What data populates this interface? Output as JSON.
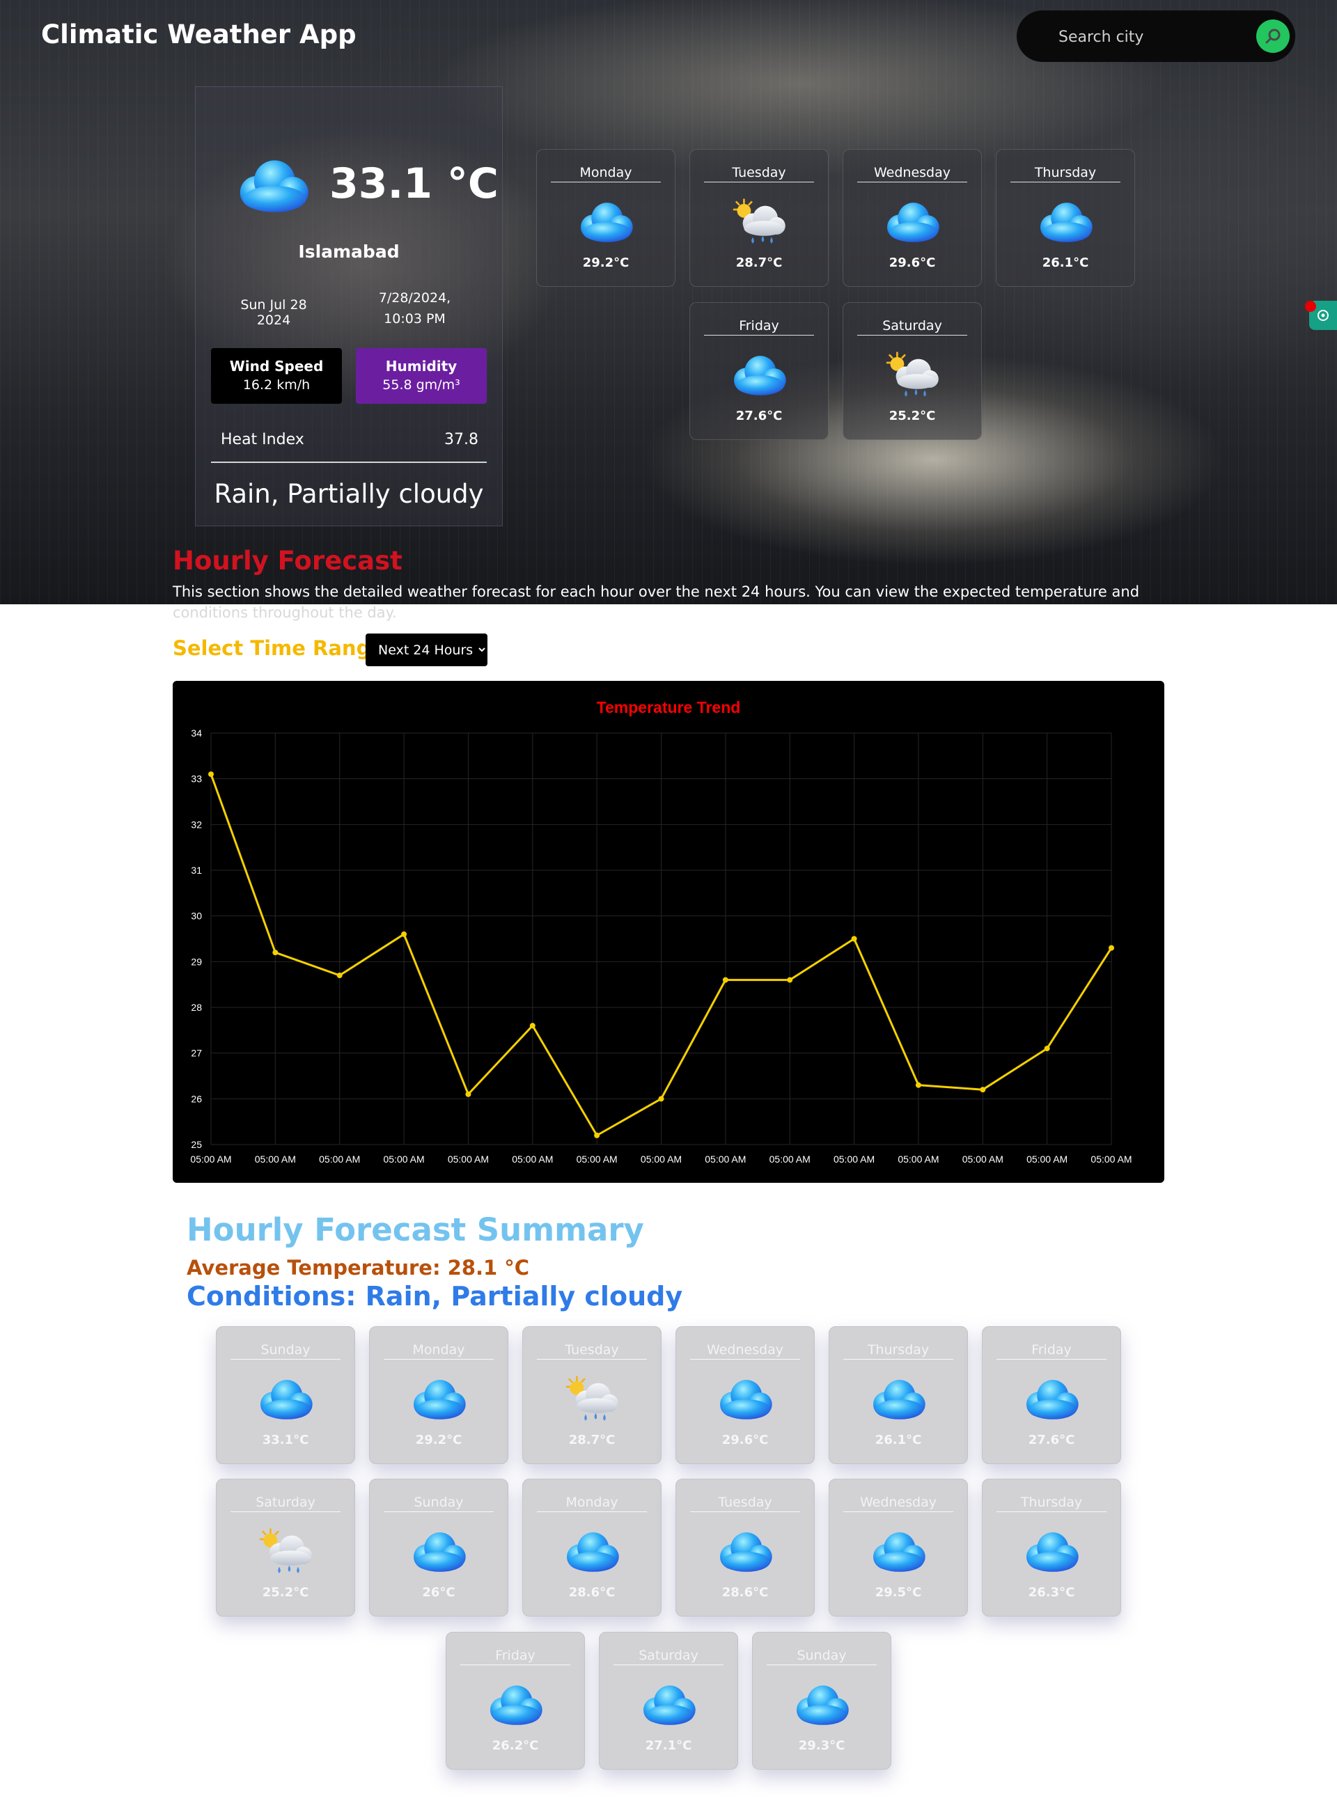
{
  "app": {
    "title": "Climatic Weather App"
  },
  "search": {
    "placeholder": "Search city",
    "button_icon": "search-icon"
  },
  "current": {
    "temp": "33.1 °C",
    "icon": "cloud-icon",
    "city": "Islamabad",
    "date": "Sun Jul 28 2024",
    "datetime": "7/28/2024, 10:03 PM",
    "wind_label": "Wind Speed",
    "wind_value": "16.2 km/h",
    "humidity_label": "Humidity",
    "humidity_value": "55.8 gm/m³",
    "heat_label": "Heat Index",
    "heat_value": "37.8",
    "condition": "Rain, Partially cloudy"
  },
  "week": [
    {
      "day": "Monday",
      "temp": "29.2°C",
      "icon": "cloud-icon"
    },
    {
      "day": "Tuesday",
      "temp": "28.7°C",
      "icon": "sun-rain-cloud-icon"
    },
    {
      "day": "Wednesday",
      "temp": "29.6°C",
      "icon": "cloud-icon"
    },
    {
      "day": "Thursday",
      "temp": "26.1°C",
      "icon": "cloud-icon"
    },
    {
      "day": "Friday",
      "temp": "27.6°C",
      "icon": "cloud-icon"
    },
    {
      "day": "Saturday",
      "temp": "25.2°C",
      "icon": "sun-rain-cloud-icon"
    }
  ],
  "hourly": {
    "title": "Hourly Forecast",
    "description": "This section shows the detailed weather forecast for each hour over the next 24 hours. You can view the expected temperature and weather",
    "description_cont": "conditions throughout the day.",
    "range_label": "Select Time Range:",
    "range_selected": "Next 24 Hours"
  },
  "chart_data": {
    "type": "line",
    "title": "Temperature Trend",
    "categories": [
      "05:00 AM",
      "05:00 AM",
      "05:00 AM",
      "05:00 AM",
      "05:00 AM",
      "05:00 AM",
      "05:00 AM",
      "05:00 AM",
      "05:00 AM",
      "05:00 AM",
      "05:00 AM",
      "05:00 AM",
      "05:00 AM",
      "05:00 AM",
      "05:00 AM"
    ],
    "series": [
      {
        "values": [
          33.1,
          29.2,
          28.7,
          29.6,
          26.1,
          27.6,
          25.2,
          26,
          28.6,
          28.6,
          29.5,
          26.3,
          26.2,
          27.1,
          29.3
        ]
      }
    ],
    "ylim": [
      25,
      34
    ],
    "yticks": [
      25,
      26,
      27,
      28,
      29,
      30,
      31,
      32,
      33,
      34
    ],
    "grid": true,
    "colors": {
      "line": "#f5d000",
      "title": "#ff0000",
      "background": "#000000",
      "ticks": "#ffffff"
    }
  },
  "summary": {
    "title": "Hourly Forecast Summary",
    "average": "Average Temperature: 28.1 °C",
    "conditions": "Conditions: Rain, Partially cloudy",
    "cards": [
      {
        "day": "Sunday",
        "temp": "33.1°C",
        "icon": "cloud-icon"
      },
      {
        "day": "Monday",
        "temp": "29.2°C",
        "icon": "cloud-icon"
      },
      {
        "day": "Tuesday",
        "temp": "28.7°C",
        "icon": "sun-rain-cloud-icon"
      },
      {
        "day": "Wednesday",
        "temp": "29.6°C",
        "icon": "cloud-icon"
      },
      {
        "day": "Thursday",
        "temp": "26.1°C",
        "icon": "cloud-icon"
      },
      {
        "day": "Friday",
        "temp": "27.6°C",
        "icon": "cloud-icon"
      },
      {
        "day": "Saturday",
        "temp": "25.2°C",
        "icon": "sun-rain-cloud-icon"
      },
      {
        "day": "Sunday",
        "temp": "26°C",
        "icon": "cloud-icon"
      },
      {
        "day": "Monday",
        "temp": "28.6°C",
        "icon": "cloud-icon"
      },
      {
        "day": "Tuesday",
        "temp": "28.6°C",
        "icon": "cloud-icon"
      },
      {
        "day": "Wednesday",
        "temp": "29.5°C",
        "icon": "cloud-icon"
      },
      {
        "day": "Thursday",
        "temp": "26.3°C",
        "icon": "cloud-icon"
      },
      {
        "day": "Friday",
        "temp": "26.2°C",
        "icon": "cloud-icon"
      },
      {
        "day": "Saturday",
        "temp": "27.1°C",
        "icon": "cloud-icon"
      },
      {
        "day": "Sunday",
        "temp": "29.3°C",
        "icon": "cloud-icon"
      }
    ]
  }
}
